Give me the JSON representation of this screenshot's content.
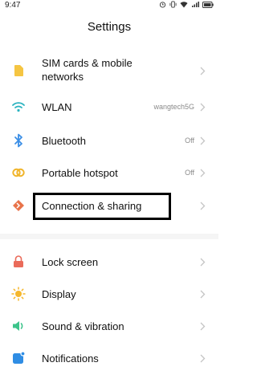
{
  "status_bar": {
    "time": "9:47"
  },
  "header": {
    "title": "Settings"
  },
  "groups": [
    {
      "items": [
        {
          "label_line1": "SIM cards & mobile",
          "label_line2": "networks",
          "value": "",
          "icon": "sim-card-icon",
          "color": "#f5c542"
        },
        {
          "label": "WLAN",
          "value": "wangtech5G",
          "icon": "wifi-icon",
          "color": "#2bb3c0"
        },
        {
          "label": "Bluetooth",
          "value": "Off",
          "icon": "bluetooth-icon",
          "color": "#3a8ee6"
        },
        {
          "label": "Portable hotspot",
          "value": "Off",
          "icon": "hotspot-icon",
          "color": "#f0b429"
        },
        {
          "label": "Connection & sharing",
          "value": "",
          "icon": "connection-sharing-icon",
          "color": "#e8734a"
        }
      ]
    },
    {
      "items": [
        {
          "label": "Lock screen",
          "value": "",
          "icon": "lock-icon",
          "color": "#ea6b5a"
        },
        {
          "label": "Display",
          "value": "",
          "icon": "sun-icon",
          "color": "#f5b72c"
        },
        {
          "label": "Sound & vibration",
          "value": "",
          "icon": "speaker-icon",
          "color": "#3dc48b"
        },
        {
          "label": "Notifications",
          "value": "",
          "icon": "notification-icon",
          "color": "#2f8de4"
        }
      ]
    }
  ]
}
